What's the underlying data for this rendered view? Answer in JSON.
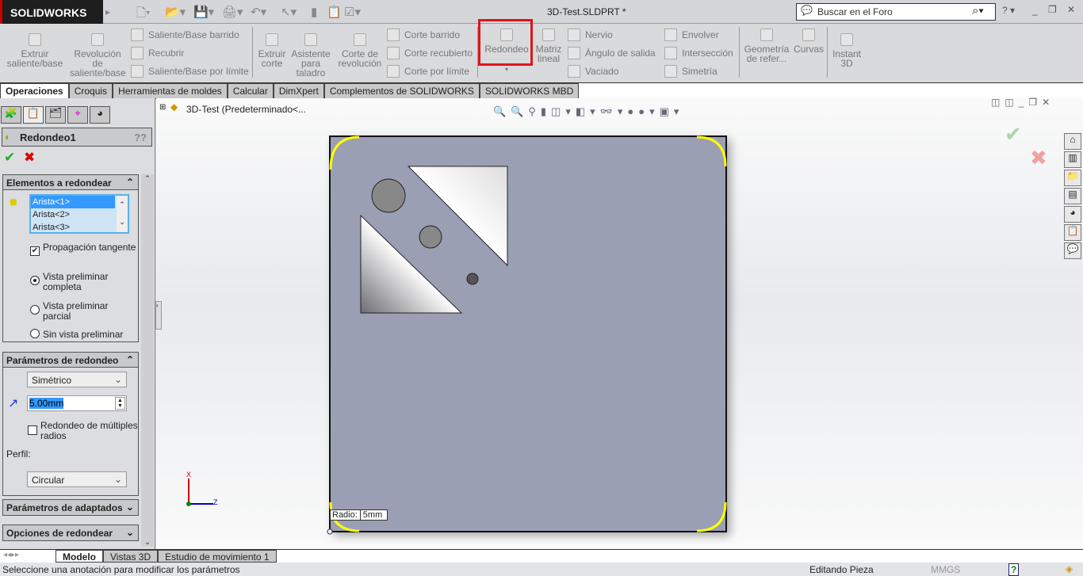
{
  "app": {
    "logo": "SOLIDWORKS",
    "title": "3D-Test.SLDPRT *",
    "search_placeholder": "Buscar en el Foro"
  },
  "ribbon": {
    "big": [
      {
        "label": "Extruir saliente/base"
      },
      {
        "label": "Revolución de saliente/base"
      },
      {
        "label": "Extruir corte"
      },
      {
        "label": "Asistente para taladro"
      },
      {
        "label": "Corte de revolución"
      },
      {
        "label": "Redondeo"
      },
      {
        "label": "Matriz lineal"
      },
      {
        "label": "Geometría de refer..."
      },
      {
        "label": "Curvas"
      },
      {
        "label": "Instant 3D"
      }
    ],
    "small": [
      {
        "label": "Saliente/Base barrido"
      },
      {
        "label": "Recubrir"
      },
      {
        "label": "Saliente/Base por límite"
      },
      {
        "label": "Corte barrido"
      },
      {
        "label": "Corte recubierto"
      },
      {
        "label": "Corte por límite"
      },
      {
        "label": "Nervio"
      },
      {
        "label": "Ángulo de salida"
      },
      {
        "label": "Vaciado"
      },
      {
        "label": "Envolver"
      },
      {
        "label": "Intersección"
      },
      {
        "label": "Simetría"
      }
    ]
  },
  "tabs": [
    "Operaciones",
    "Croquis",
    "Herramientas de moldes",
    "Calcular",
    "DimXpert",
    "Complementos de SOLIDWORKS",
    "SOLIDWORKS MBD"
  ],
  "tree": {
    "item": "3D-Test  (Predeterminado<..."
  },
  "pm": {
    "title": "Redondeo1",
    "items_group": {
      "title": "Elementos a redondear",
      "edges": [
        "Arista<1>",
        "Arista<2>",
        "Arista<3>"
      ],
      "tangent": "Propagación tangente",
      "tangent_checked": true,
      "preview_options": [
        "Vista preliminar completa",
        "Vista preliminar parcial",
        "Sin vista preliminar"
      ],
      "preview_selected": 0
    },
    "params_group": {
      "title": "Parámetros de redondeo",
      "type": "Simétrico",
      "radius": "5.00mm",
      "multi": "Redondeo de múltiples radios",
      "multi_checked": false,
      "profile_label": "Perfil:",
      "profile": "Circular"
    },
    "setback_group": {
      "title": "Parámetros de adaptados"
    },
    "options_group": {
      "title": "Opciones de redondear"
    }
  },
  "viewport": {
    "callout_label": "Radio:",
    "callout_value": "5mm",
    "axis_x": "X",
    "axis_z": "Z",
    "highlight_color": "#ffff00",
    "part_color": "#9a9fb4"
  },
  "bottom_tabs": [
    "Modelo",
    "Vistas 3D",
    "Estudio de movimiento 1"
  ],
  "status": {
    "message": "Seleccione una anotación para modificar los parámetros",
    "mode": "Editando Pieza",
    "units": "MMGS"
  }
}
